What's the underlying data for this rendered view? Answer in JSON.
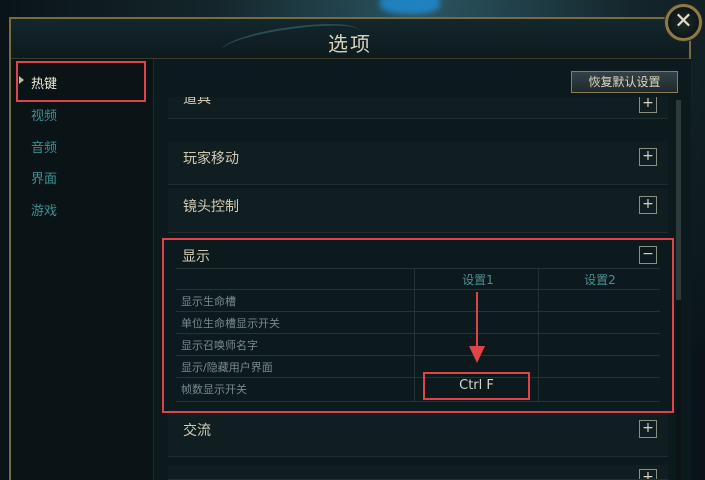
{
  "window": {
    "title": "选项",
    "close_glyph": "✕"
  },
  "sidebar": {
    "items": [
      {
        "label": "热键",
        "active": true
      },
      {
        "label": "视频",
        "active": false
      },
      {
        "label": "音频",
        "active": false
      },
      {
        "label": "界面",
        "active": false
      },
      {
        "label": "游戏",
        "active": false
      }
    ]
  },
  "toolbar": {
    "restore_label": "恢复默认设置"
  },
  "sections": {
    "items_partial": {
      "title": "道具",
      "toggle": "+"
    },
    "player_move": {
      "title": "玩家移动",
      "toggle": "+"
    },
    "camera": {
      "title": "镜头控制",
      "toggle": "+"
    },
    "display": {
      "title": "显示",
      "toggle": "−",
      "col1": "设置1",
      "col2": "设置2",
      "rows": [
        {
          "label": "显示生命槽",
          "key1": "",
          "key2": ""
        },
        {
          "label": "单位生命槽显示开关",
          "key1": "",
          "key2": ""
        },
        {
          "label": "显示召唤师名字",
          "key1": "",
          "key2": ""
        },
        {
          "label": "显示/隐藏用户界面",
          "key1": "",
          "key2": ""
        },
        {
          "label": "帧数显示开关",
          "key1": "Ctrl  F",
          "key2": ""
        }
      ]
    },
    "chat": {
      "title": "交流",
      "toggle": "+"
    },
    "next_partial": {
      "title": "",
      "toggle": "+"
    }
  },
  "colors": {
    "accent_highlight": "#e0444a",
    "gold_border": "#8d7a4c",
    "teal_text": "#3d8f92"
  },
  "icons": {
    "close": "close-icon",
    "expand": "plus-icon",
    "collapse": "minus-icon"
  }
}
